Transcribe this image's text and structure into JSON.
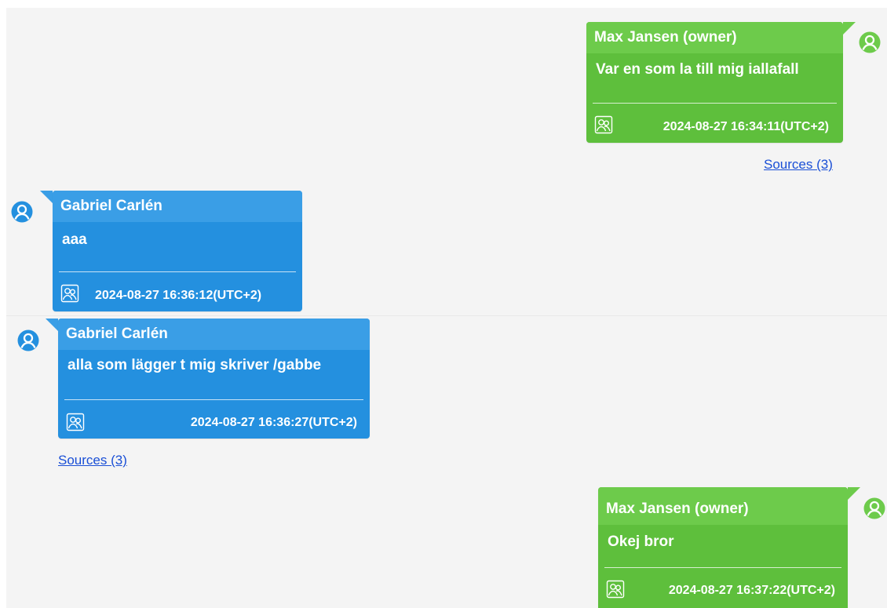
{
  "messages": [
    {
      "sender": "Max Jansen (owner)",
      "text": "Var en som la till mig iallafall",
      "timestamp": "2024-08-27 16:34:11(UTC+2)",
      "side": "right",
      "color": "#5ebf3c"
    },
    {
      "sender": "Gabriel Carlén",
      "text": "aaa",
      "timestamp": "2024-08-27 16:36:12(UTC+2)",
      "side": "left",
      "color": "#2490df"
    },
    {
      "sender": "Gabriel Carlén",
      "text": "alla som lägger t mig skriver /gabbe",
      "timestamp": "2024-08-27 16:36:27(UTC+2)",
      "side": "left",
      "color": "#2490df"
    },
    {
      "sender": "Max Jansen (owner)",
      "text": "Okej bror",
      "timestamp": "2024-08-27 16:37:22(UTC+2)",
      "side": "right",
      "color": "#5ebf3c"
    }
  ],
  "sources_links": [
    "Sources (3)",
    "Sources (3)"
  ],
  "icons": {
    "avatar": "user-avatar-icon",
    "participants": "participants-icon"
  }
}
